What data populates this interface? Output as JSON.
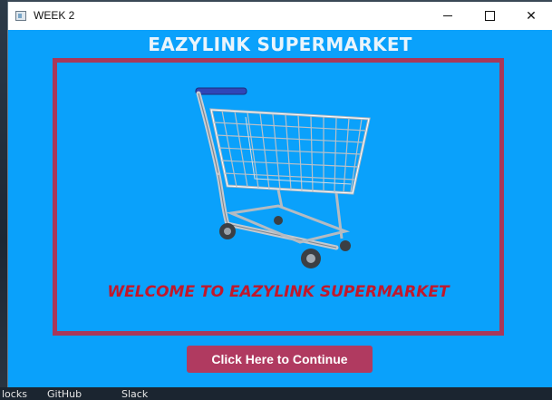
{
  "window": {
    "title": "WEEK 2",
    "minimize_icon": "minimize-icon",
    "maximize_icon": "maximize-icon",
    "close_icon": "close-icon",
    "close_glyph": "✕"
  },
  "main": {
    "heading": "EAZYLINK SUPERMARKET",
    "image_icon": "shopping-cart-icon",
    "welcome_text": "WELCOME TO EAZYLINK SUPERMARKET",
    "continue_label": "Click Here to Continue"
  },
  "taskbar": {
    "items": [
      "locks",
      "GitHub",
      "Slack"
    ]
  },
  "colors": {
    "window_background": "#0aa1fb",
    "frame_border": "#a8385a",
    "welcome_text": "#c0182c",
    "button_background": "#b03a60",
    "heading_text": "#eaf4fb"
  }
}
